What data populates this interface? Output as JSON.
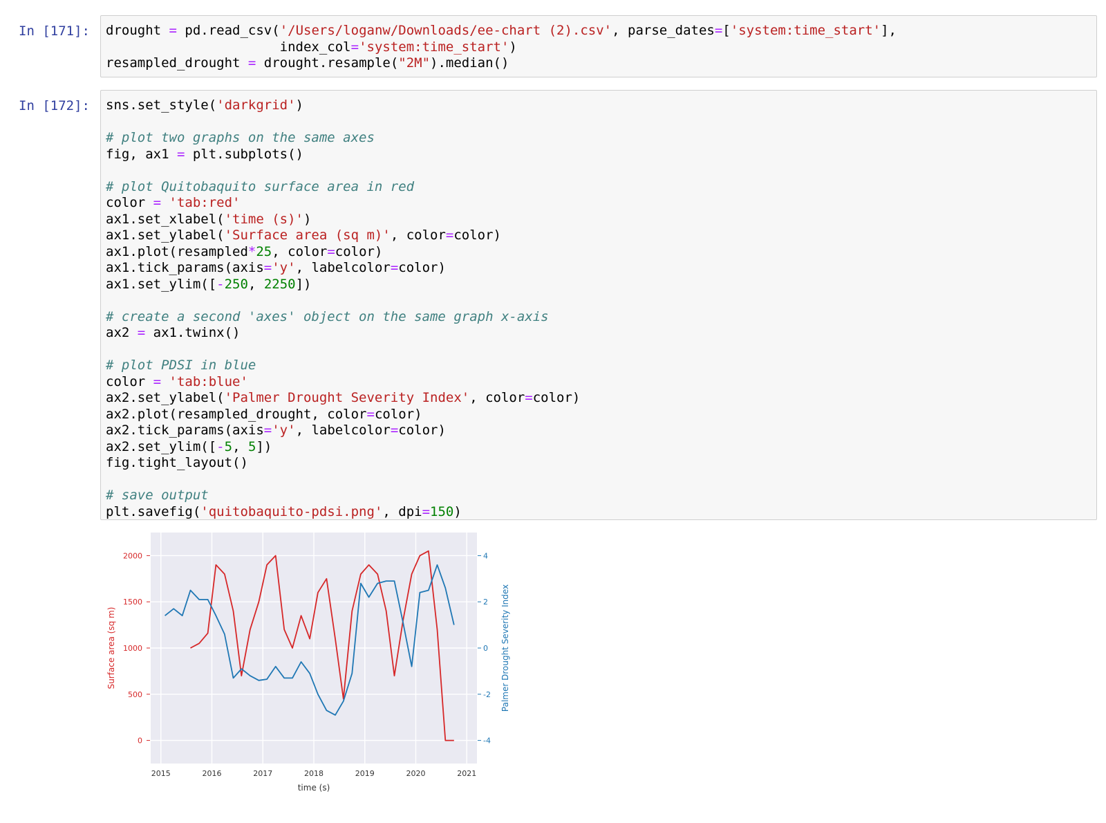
{
  "cells": [
    {
      "prompt": "In [171]:",
      "lines": [
        [
          [
            "p",
            "drought "
          ],
          [
            "o",
            "="
          ],
          [
            "p",
            " pd.read_csv("
          ],
          [
            "s",
            "'/Users/loganw/Downloads/ee-chart (2).csv'"
          ],
          [
            "p",
            ", parse_dates"
          ],
          [
            "o",
            "="
          ],
          [
            "p",
            "["
          ],
          [
            "s",
            "'system:time_start'"
          ],
          [
            "p",
            "],"
          ]
        ],
        [
          [
            "p",
            "                      index_col"
          ],
          [
            "o",
            "="
          ],
          [
            "s",
            "'system:time_start'"
          ],
          [
            "p",
            ")"
          ]
        ],
        [
          [
            "p",
            "resampled_drought "
          ],
          [
            "o",
            "="
          ],
          [
            "p",
            " drought.resample("
          ],
          [
            "s",
            "\"2M\""
          ],
          [
            "p",
            ").median()"
          ]
        ]
      ]
    },
    {
      "prompt": "In [172]:",
      "lines": [
        [
          [
            "p",
            "sns.set_style("
          ],
          [
            "s",
            "'darkgrid'"
          ],
          [
            "p",
            ")"
          ]
        ],
        [
          [
            "p",
            ""
          ]
        ],
        [
          [
            "c",
            "# plot two graphs on the same axes"
          ]
        ],
        [
          [
            "p",
            "fig, ax1 "
          ],
          [
            "o",
            "="
          ],
          [
            "p",
            " plt.subplots()"
          ]
        ],
        [
          [
            "p",
            ""
          ]
        ],
        [
          [
            "c",
            "# plot Quitobaquito surface area in red"
          ]
        ],
        [
          [
            "p",
            "color "
          ],
          [
            "o",
            "="
          ],
          [
            "p",
            " "
          ],
          [
            "s",
            "'tab:red'"
          ]
        ],
        [
          [
            "p",
            "ax1.set_xlabel("
          ],
          [
            "s",
            "'time (s)'"
          ],
          [
            "p",
            ")"
          ]
        ],
        [
          [
            "p",
            "ax1.set_ylabel("
          ],
          [
            "s",
            "'Surface area (sq m)'"
          ],
          [
            "p",
            ", color"
          ],
          [
            "o",
            "="
          ],
          [
            "p",
            "color)"
          ]
        ],
        [
          [
            "p",
            "ax1.plot(resampled"
          ],
          [
            "o",
            "*"
          ],
          [
            "n",
            "25"
          ],
          [
            "p",
            ", color"
          ],
          [
            "o",
            "="
          ],
          [
            "p",
            "color)"
          ]
        ],
        [
          [
            "p",
            "ax1.tick_params(axis"
          ],
          [
            "o",
            "="
          ],
          [
            "s",
            "'y'"
          ],
          [
            "p",
            ", labelcolor"
          ],
          [
            "o",
            "="
          ],
          [
            "p",
            "color)"
          ]
        ],
        [
          [
            "p",
            "ax1.set_ylim(["
          ],
          [
            "o",
            "-"
          ],
          [
            "n",
            "250"
          ],
          [
            "p",
            ", "
          ],
          [
            "n",
            "2250"
          ],
          [
            "p",
            "])"
          ]
        ],
        [
          [
            "p",
            ""
          ]
        ],
        [
          [
            "c",
            "# create a second 'axes' object on the same graph x-axis"
          ]
        ],
        [
          [
            "p",
            "ax2 "
          ],
          [
            "o",
            "="
          ],
          [
            "p",
            " ax1.twinx()"
          ]
        ],
        [
          [
            "p",
            ""
          ]
        ],
        [
          [
            "c",
            "# plot PDSI in blue"
          ]
        ],
        [
          [
            "p",
            "color "
          ],
          [
            "o",
            "="
          ],
          [
            "p",
            " "
          ],
          [
            "s",
            "'tab:blue'"
          ]
        ],
        [
          [
            "p",
            "ax2.set_ylabel("
          ],
          [
            "s",
            "'Palmer Drought Severity Index'"
          ],
          [
            "p",
            ", color"
          ],
          [
            "o",
            "="
          ],
          [
            "p",
            "color)"
          ]
        ],
        [
          [
            "p",
            "ax2.plot(resampled_drought, color"
          ],
          [
            "o",
            "="
          ],
          [
            "p",
            "color)"
          ]
        ],
        [
          [
            "p",
            "ax2.tick_params(axis"
          ],
          [
            "o",
            "="
          ],
          [
            "s",
            "'y'"
          ],
          [
            "p",
            ", labelcolor"
          ],
          [
            "o",
            "="
          ],
          [
            "p",
            "color)"
          ]
        ],
        [
          [
            "p",
            "ax2.set_ylim(["
          ],
          [
            "o",
            "-"
          ],
          [
            "n",
            "5"
          ],
          [
            "p",
            ", "
          ],
          [
            "n",
            "5"
          ],
          [
            "p",
            "])"
          ]
        ],
        [
          [
            "p",
            "fig.tight_layout()"
          ]
        ],
        [
          [
            "p",
            ""
          ]
        ],
        [
          [
            "c",
            "# save output"
          ]
        ],
        [
          [
            "p",
            "plt.savefig("
          ],
          [
            "s",
            "'quitobaquito-pdsi.png'"
          ],
          [
            "p",
            ", dpi"
          ],
          [
            "o",
            "="
          ],
          [
            "n",
            "150"
          ],
          [
            "p",
            ")"
          ]
        ]
      ]
    }
  ],
  "chart_data": {
    "type": "line",
    "xlabel": "time (s)",
    "ylabel_left": "Surface area (sq m)",
    "ylabel_right": "Palmer Drought Severity Index",
    "x_ticks": [
      "2015",
      "2016",
      "2017",
      "2018",
      "2019",
      "2020",
      "2021"
    ],
    "y_ticks_left": [
      "0",
      "500",
      "1000",
      "1500",
      "2000"
    ],
    "y_ticks_right": [
      "-4",
      "-2",
      "0",
      "2",
      "4"
    ],
    "xlim": [
      2014.8,
      2021.2
    ],
    "ylim_left": [
      -250,
      2250
    ],
    "ylim_right": [
      -5,
      5
    ],
    "grid": true,
    "series": [
      {
        "axis": "left",
        "color": "#d62728",
        "x": [
          2015.58,
          2015.75,
          2015.92,
          2016.08,
          2016.25,
          2016.42,
          2016.58,
          2016.75,
          2016.92,
          2017.08,
          2017.25,
          2017.42,
          2017.58,
          2017.75,
          2017.92,
          2018.08,
          2018.25,
          2018.42,
          2018.58,
          2018.75,
          2018.92,
          2019.08,
          2019.25,
          2019.42,
          2019.58,
          2019.75,
          2019.92,
          2020.08,
          2020.25,
          2020.42,
          2020.58,
          2020.75
        ],
        "values": [
          1000,
          1050,
          1160,
          1900,
          1800,
          1400,
          700,
          1200,
          1500,
          1900,
          2000,
          1200,
          1000,
          1350,
          1100,
          1600,
          1750,
          1100,
          450,
          1400,
          1800,
          1900,
          1800,
          1400,
          700,
          1300,
          1800,
          2000,
          2050,
          1200,
          0,
          0
        ]
      },
      {
        "axis": "right",
        "color": "#1f77b4",
        "x": [
          2015.08,
          2015.25,
          2015.42,
          2015.58,
          2015.75,
          2015.92,
          2016.08,
          2016.25,
          2016.42,
          2016.58,
          2016.75,
          2016.92,
          2017.08,
          2017.25,
          2017.42,
          2017.58,
          2017.75,
          2017.92,
          2018.08,
          2018.25,
          2018.42,
          2018.58,
          2018.75,
          2018.92,
          2019.08,
          2019.25,
          2019.42,
          2019.58,
          2019.75,
          2019.92,
          2020.08,
          2020.25,
          2020.42,
          2020.58,
          2020.75
        ],
        "values": [
          1.4,
          1.7,
          1.4,
          2.5,
          2.1,
          2.1,
          1.4,
          0.6,
          -1.3,
          -0.9,
          -1.2,
          -1.4,
          -1.35,
          -0.8,
          -1.3,
          -1.3,
          -0.6,
          -1.1,
          -2.0,
          -2.7,
          -2.9,
          -2.3,
          -1.1,
          2.8,
          2.2,
          2.8,
          2.9,
          2.9,
          1.1,
          -0.8,
          2.4,
          2.5,
          3.6,
          2.6,
          1.0
        ]
      }
    ]
  }
}
